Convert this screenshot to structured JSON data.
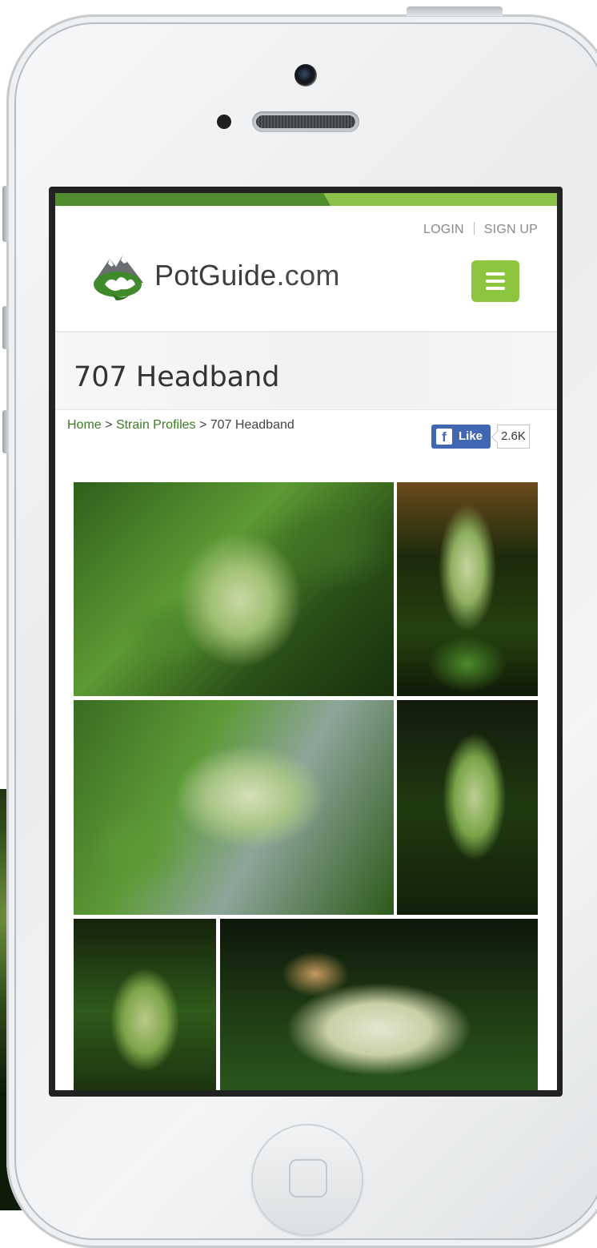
{
  "header": {
    "login_label": "LOGIN",
    "signup_label": "SIGN UP",
    "logo_text_main": "PotGuide",
    "logo_text_suffix": ".com"
  },
  "page": {
    "title": "707 Headband"
  },
  "breadcrumb": {
    "home": "Home",
    "section": "Strain Profiles",
    "current": "707 Headband",
    "separator": ">"
  },
  "facebook": {
    "like_label": "Like",
    "count": "2.6K"
  },
  "gallery": {
    "photo_count": 6
  },
  "colors": {
    "brand_green_dark": "#4f8d2f",
    "brand_green_light": "#8cc63f",
    "link_green": "#3b7d23",
    "facebook_blue": "#4267b2"
  },
  "icons": [
    "potguide-logo-icon",
    "hamburger-menu-icon",
    "facebook-f-icon"
  ]
}
